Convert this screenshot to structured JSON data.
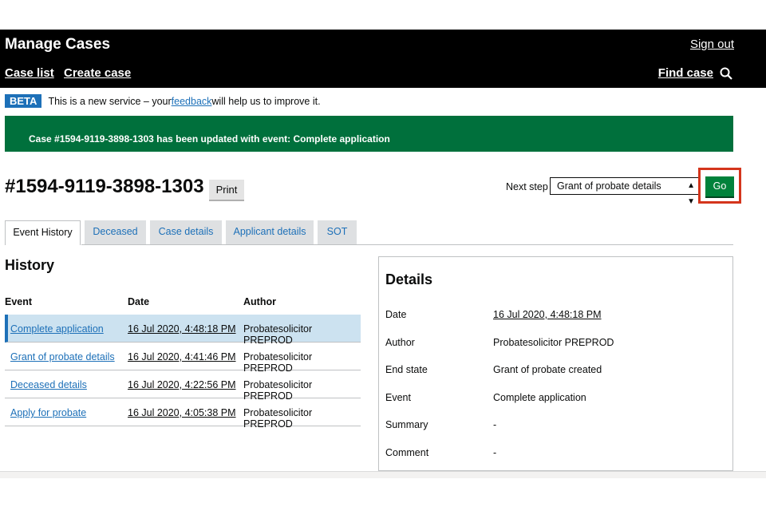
{
  "header": {
    "app_title": "Manage Cases",
    "sign_out": "Sign out",
    "nav": {
      "case_list": "Case list",
      "create_case": "Create case",
      "find_case": "Find case"
    }
  },
  "beta": {
    "tag": "BETA",
    "text_before": "This is a new service – your ",
    "link": "feedback",
    "text_after": " will help us to improve it."
  },
  "banner": {
    "message": "Case #1594-9119-3898-1303 has been updated with event: Complete application"
  },
  "case": {
    "id": "#1594-9119-3898-1303",
    "print_label": "Print"
  },
  "next_step": {
    "label": "Next step",
    "selected": "Grant of probate details",
    "go_label": "Go"
  },
  "tabs": [
    "Event History",
    "Deceased",
    "Case details",
    "Applicant details",
    "SOT"
  ],
  "history": {
    "title": "History",
    "columns": {
      "event": "Event",
      "date": "Date",
      "author": "Author"
    },
    "rows": [
      {
        "event": "Complete application",
        "date": "16 Jul 2020, 4:48:18 PM",
        "author": "Probatesolicitor PREPROD"
      },
      {
        "event": "Grant of probate details",
        "date": "16 Jul 2020, 4:41:46 PM",
        "author": "Probatesolicitor PREPROD"
      },
      {
        "event": "Deceased details",
        "date": "16 Jul 2020, 4:22:56 PM",
        "author": "Probatesolicitor PREPROD"
      },
      {
        "event": "Apply for probate",
        "date": "16 Jul 2020, 4:05:38 PM",
        "author": "Probatesolicitor PREPROD"
      }
    ]
  },
  "details": {
    "title": "Details",
    "fields": [
      {
        "label": "Date",
        "value": "16 Jul 2020, 4:48:18 PM"
      },
      {
        "label": "Author",
        "value": "Probatesolicitor PREPROD"
      },
      {
        "label": "End state",
        "value": "Grant of probate created"
      },
      {
        "label": "Event",
        "value": "Complete application"
      },
      {
        "label": "Summary",
        "value": "-"
      },
      {
        "label": "Comment",
        "value": "-"
      }
    ]
  },
  "colors": {
    "header_bg": "#000000",
    "success_green": "#00703c",
    "link_blue": "#1d70b8",
    "highlight_red": "#d4351c",
    "selected_row": "#cce2f0"
  },
  "icons": {
    "search": "search-icon",
    "select_arrows": "select-arrows-icon"
  }
}
